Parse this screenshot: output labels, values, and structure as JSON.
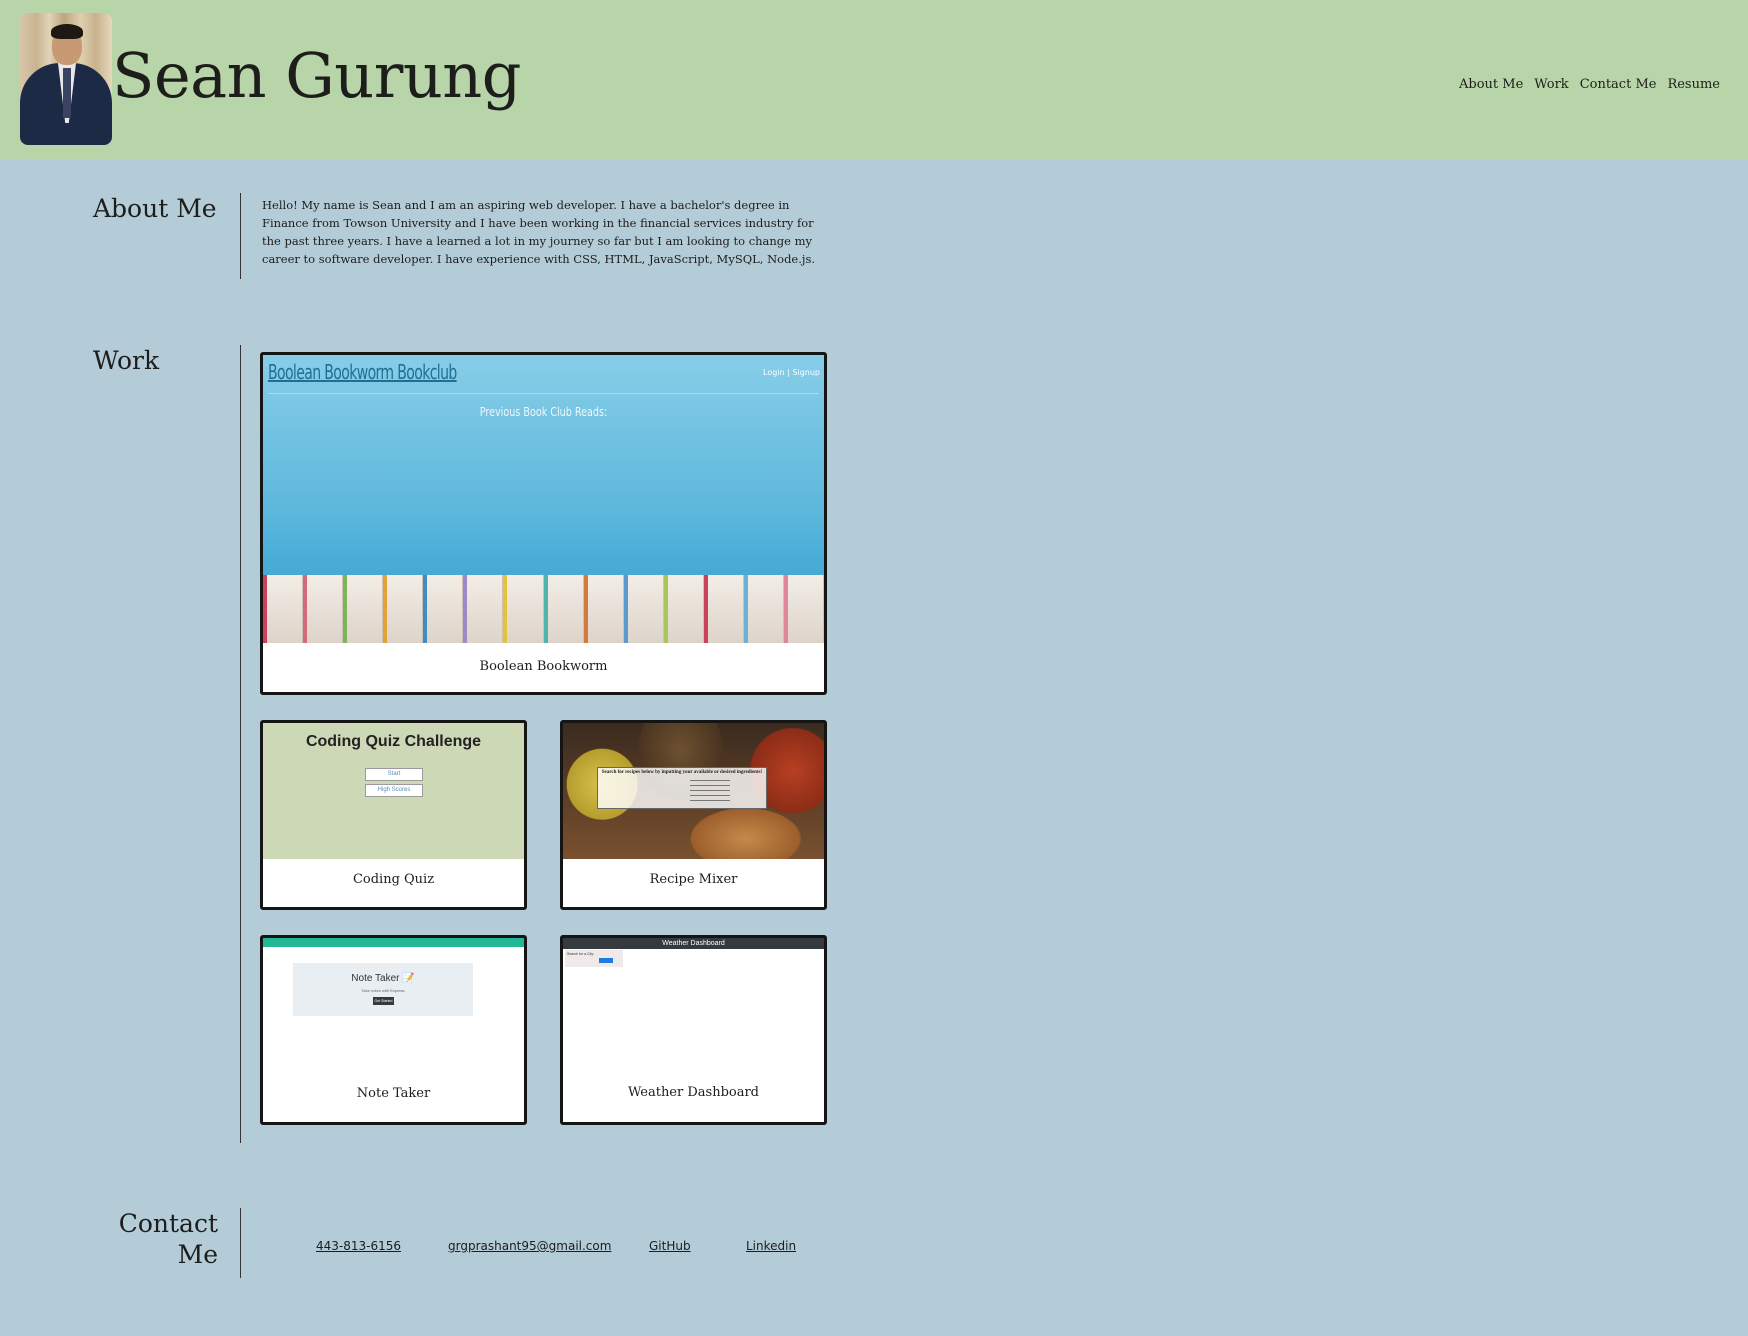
{
  "header": {
    "name": "Sean Gurung",
    "nav": [
      "About Me",
      "Work",
      "Contact Me",
      "Resume"
    ]
  },
  "about": {
    "title": "About Me",
    "text": "Hello! My name is Sean and I am an aspiring web developer. I have a bachelor's degree in Finance from Towson University and I have been working in the financial services industry for the past three years. I have a learned a lot in my journey so far but I am looking to change my career to software developer. I have experience with CSS, HTML, JavaScript, MySQL, Node.js."
  },
  "work": {
    "title": "Work",
    "projects": [
      {
        "label": "Boolean Bookworm",
        "thumb_heading": "Boolean Bookworm Bookclub",
        "thumb_login": "Login | Signup",
        "thumb_caption": "Previous Book Club Reads:"
      },
      {
        "label": "Coding Quiz",
        "thumb_heading": "Coding Quiz Challenge",
        "thumb_buttons": [
          "Start",
          "High Scores"
        ]
      },
      {
        "label": "Recipe Mixer",
        "thumb_heading": "Search for recipes below by inputting your available or desired ingredients!"
      },
      {
        "label": "Note Taker",
        "thumb_heading": "Note Taker 📝",
        "thumb_sub": "Take notes with Express",
        "thumb_button": "Get Started"
      },
      {
        "label": "Weather Dashboard",
        "thumb_heading": "Weather Dashboard",
        "thumb_search": "Search for a City:"
      }
    ]
  },
  "contact": {
    "title": "Contact Me",
    "phone": "443-813-6156",
    "email": "grgprashant95@gmail.com",
    "github": "GitHub",
    "linkedin": "Linkedin"
  }
}
